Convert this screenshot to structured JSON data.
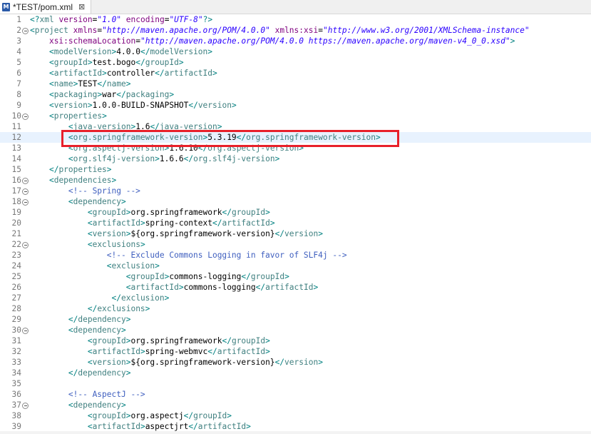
{
  "tab": {
    "title": "*TEST/pom.xml",
    "icon_letter": "M",
    "close_glyph": "⊠"
  },
  "colors": {
    "tag": "#3f7f7f",
    "attribute": "#7f007f",
    "attribute_value": "#2a00ff",
    "comment": "#3f5fbf",
    "highlight_box": "#e8202a"
  },
  "current_line": 12,
  "highlighted_line": 12,
  "lines": [
    {
      "n": "1",
      "fold": false,
      "indent": 0,
      "tokens": [
        [
          "p",
          "<?"
        ],
        [
          "t",
          "xml"
        ],
        [
          "x",
          " "
        ],
        [
          "a",
          "version"
        ],
        [
          "x",
          "="
        ],
        [
          "v",
          "\"1.0\""
        ],
        [
          "x",
          " "
        ],
        [
          "a",
          "encoding"
        ],
        [
          "x",
          "="
        ],
        [
          "v",
          "\"UTF-8\""
        ],
        [
          "p",
          "?>"
        ]
      ]
    },
    {
      "n": "2",
      "fold": true,
      "indent": 0,
      "tokens": [
        [
          "p",
          "<"
        ],
        [
          "t",
          "project"
        ],
        [
          "x",
          " "
        ],
        [
          "a",
          "xmlns"
        ],
        [
          "x",
          "="
        ],
        [
          "v",
          "\"http://maven.apache.org/POM/4.0.0\""
        ],
        [
          "x",
          " "
        ],
        [
          "a",
          "xmlns:xsi"
        ],
        [
          "x",
          "="
        ],
        [
          "v",
          "\"http://www.w3.org/2001/XMLSchema-instance\""
        ]
      ]
    },
    {
      "n": "3",
      "fold": false,
      "indent": 4,
      "tokens": [
        [
          "a",
          "xsi:schemaLocation"
        ],
        [
          "x",
          "="
        ],
        [
          "v",
          "\"http://maven.apache.org/POM/4.0.0 https://maven.apache.org/maven-v4_0_0.xsd\""
        ],
        [
          "p",
          ">"
        ]
      ]
    },
    {
      "n": "4",
      "fold": false,
      "indent": 4,
      "tokens": [
        [
          "p",
          "<"
        ],
        [
          "t",
          "modelVersion"
        ],
        [
          "p",
          ">"
        ],
        [
          "x",
          "4.0.0"
        ],
        [
          "p",
          "</"
        ],
        [
          "t",
          "modelVersion"
        ],
        [
          "p",
          ">"
        ]
      ]
    },
    {
      "n": "5",
      "fold": false,
      "indent": 4,
      "tokens": [
        [
          "p",
          "<"
        ],
        [
          "t",
          "groupId"
        ],
        [
          "p",
          ">"
        ],
        [
          "x",
          "test.bogo"
        ],
        [
          "p",
          "</"
        ],
        [
          "t",
          "groupId"
        ],
        [
          "p",
          ">"
        ]
      ]
    },
    {
      "n": "6",
      "fold": false,
      "indent": 4,
      "tokens": [
        [
          "p",
          "<"
        ],
        [
          "t",
          "artifactId"
        ],
        [
          "p",
          ">"
        ],
        [
          "x",
          "controller"
        ],
        [
          "p",
          "</"
        ],
        [
          "t",
          "artifactId"
        ],
        [
          "p",
          ">"
        ]
      ]
    },
    {
      "n": "7",
      "fold": false,
      "indent": 4,
      "tokens": [
        [
          "p",
          "<"
        ],
        [
          "t",
          "name"
        ],
        [
          "p",
          ">"
        ],
        [
          "x",
          "TEST"
        ],
        [
          "p",
          "</"
        ],
        [
          "t",
          "name"
        ],
        [
          "p",
          ">"
        ]
      ]
    },
    {
      "n": "8",
      "fold": false,
      "indent": 4,
      "tokens": [
        [
          "p",
          "<"
        ],
        [
          "t",
          "packaging"
        ],
        [
          "p",
          ">"
        ],
        [
          "x",
          "war"
        ],
        [
          "p",
          "</"
        ],
        [
          "t",
          "packaging"
        ],
        [
          "p",
          ">"
        ]
      ]
    },
    {
      "n": "9",
      "fold": false,
      "indent": 4,
      "tokens": [
        [
          "p",
          "<"
        ],
        [
          "t",
          "version"
        ],
        [
          "p",
          ">"
        ],
        [
          "x",
          "1.0.0-BUILD-SNAPSHOT"
        ],
        [
          "p",
          "</"
        ],
        [
          "t",
          "version"
        ],
        [
          "p",
          ">"
        ]
      ]
    },
    {
      "n": "10",
      "fold": true,
      "indent": 4,
      "tokens": [
        [
          "p",
          "<"
        ],
        [
          "t",
          "properties"
        ],
        [
          "p",
          ">"
        ]
      ]
    },
    {
      "n": "11",
      "fold": false,
      "indent": 8,
      "tokens": [
        [
          "p",
          "<"
        ],
        [
          "t",
          "java-version"
        ],
        [
          "p",
          ">"
        ],
        [
          "x",
          "1.6"
        ],
        [
          "p",
          "</"
        ],
        [
          "t",
          "java-version"
        ],
        [
          "p",
          ">"
        ]
      ]
    },
    {
      "n": "12",
      "fold": false,
      "indent": 8,
      "tokens": [
        [
          "p",
          "<"
        ],
        [
          "t",
          "org.springframework-version"
        ],
        [
          "p",
          ">"
        ],
        [
          "x",
          "5.3.19"
        ],
        [
          "p",
          "</"
        ],
        [
          "t",
          "org.springframework-version"
        ],
        [
          "p",
          ">"
        ]
      ]
    },
    {
      "n": "13",
      "fold": false,
      "indent": 8,
      "tokens": [
        [
          "p",
          "<"
        ],
        [
          "t",
          "org.aspectj-version"
        ],
        [
          "p",
          ">"
        ],
        [
          "x",
          "1.6.10"
        ],
        [
          "p",
          "</"
        ],
        [
          "t",
          "org.aspectj-version"
        ],
        [
          "p",
          ">"
        ]
      ]
    },
    {
      "n": "14",
      "fold": false,
      "indent": 8,
      "tokens": [
        [
          "p",
          "<"
        ],
        [
          "t",
          "org.slf4j-version"
        ],
        [
          "p",
          ">"
        ],
        [
          "x",
          "1.6.6"
        ],
        [
          "p",
          "</"
        ],
        [
          "t",
          "org.slf4j-version"
        ],
        [
          "p",
          ">"
        ]
      ]
    },
    {
      "n": "15",
      "fold": false,
      "indent": 4,
      "tokens": [
        [
          "p",
          "</"
        ],
        [
          "t",
          "properties"
        ],
        [
          "p",
          ">"
        ]
      ]
    },
    {
      "n": "16",
      "fold": true,
      "indent": 4,
      "tokens": [
        [
          "p",
          "<"
        ],
        [
          "t",
          "dependencies"
        ],
        [
          "p",
          ">"
        ]
      ]
    },
    {
      "n": "17",
      "fold": true,
      "indent": 8,
      "tokens": [
        [
          "c",
          "<!-- Spring -->"
        ]
      ]
    },
    {
      "n": "18",
      "fold": true,
      "indent": 8,
      "tokens": [
        [
          "p",
          "<"
        ],
        [
          "t",
          "dependency"
        ],
        [
          "p",
          ">"
        ]
      ]
    },
    {
      "n": "19",
      "fold": false,
      "indent": 12,
      "tokens": [
        [
          "p",
          "<"
        ],
        [
          "t",
          "groupId"
        ],
        [
          "p",
          ">"
        ],
        [
          "x",
          "org.springframework"
        ],
        [
          "p",
          "</"
        ],
        [
          "t",
          "groupId"
        ],
        [
          "p",
          ">"
        ]
      ]
    },
    {
      "n": "20",
      "fold": false,
      "indent": 12,
      "tokens": [
        [
          "p",
          "<"
        ],
        [
          "t",
          "artifactId"
        ],
        [
          "p",
          ">"
        ],
        [
          "x",
          "spring-context"
        ],
        [
          "p",
          "</"
        ],
        [
          "t",
          "artifactId"
        ],
        [
          "p",
          ">"
        ]
      ]
    },
    {
      "n": "21",
      "fold": false,
      "indent": 12,
      "tokens": [
        [
          "p",
          "<"
        ],
        [
          "t",
          "version"
        ],
        [
          "p",
          ">"
        ],
        [
          "x",
          "${org.springframework-version}"
        ],
        [
          "p",
          "</"
        ],
        [
          "t",
          "version"
        ],
        [
          "p",
          ">"
        ]
      ]
    },
    {
      "n": "22",
      "fold": true,
      "indent": 12,
      "tokens": [
        [
          "p",
          "<"
        ],
        [
          "t",
          "exclusions"
        ],
        [
          "p",
          ">"
        ]
      ]
    },
    {
      "n": "23",
      "fold": false,
      "indent": 16,
      "tokens": [
        [
          "c",
          "<!-- Exclude Commons Logging in favor of SLF4j -->"
        ]
      ]
    },
    {
      "n": "24",
      "fold": false,
      "indent": 16,
      "tokens": [
        [
          "p",
          "<"
        ],
        [
          "t",
          "exclusion"
        ],
        [
          "p",
          ">"
        ]
      ]
    },
    {
      "n": "25",
      "fold": false,
      "indent": 20,
      "tokens": [
        [
          "p",
          "<"
        ],
        [
          "t",
          "groupId"
        ],
        [
          "p",
          ">"
        ],
        [
          "x",
          "commons-logging"
        ],
        [
          "p",
          "</"
        ],
        [
          "t",
          "groupId"
        ],
        [
          "p",
          ">"
        ]
      ]
    },
    {
      "n": "26",
      "fold": false,
      "indent": 20,
      "tokens": [
        [
          "p",
          "<"
        ],
        [
          "t",
          "artifactId"
        ],
        [
          "p",
          ">"
        ],
        [
          "x",
          "commons-logging"
        ],
        [
          "p",
          "</"
        ],
        [
          "t",
          "artifactId"
        ],
        [
          "p",
          ">"
        ]
      ]
    },
    {
      "n": "27",
      "fold": false,
      "indent": 17,
      "tokens": [
        [
          "p",
          "</"
        ],
        [
          "t",
          "exclusion"
        ],
        [
          "p",
          ">"
        ]
      ]
    },
    {
      "n": "28",
      "fold": false,
      "indent": 12,
      "tokens": [
        [
          "p",
          "</"
        ],
        [
          "t",
          "exclusions"
        ],
        [
          "p",
          ">"
        ]
      ]
    },
    {
      "n": "29",
      "fold": false,
      "indent": 8,
      "tokens": [
        [
          "p",
          "</"
        ],
        [
          "t",
          "dependency"
        ],
        [
          "p",
          ">"
        ]
      ]
    },
    {
      "n": "30",
      "fold": true,
      "indent": 8,
      "tokens": [
        [
          "p",
          "<"
        ],
        [
          "t",
          "dependency"
        ],
        [
          "p",
          ">"
        ]
      ]
    },
    {
      "n": "31",
      "fold": false,
      "indent": 12,
      "tokens": [
        [
          "p",
          "<"
        ],
        [
          "t",
          "groupId"
        ],
        [
          "p",
          ">"
        ],
        [
          "x",
          "org.springframework"
        ],
        [
          "p",
          "</"
        ],
        [
          "t",
          "groupId"
        ],
        [
          "p",
          ">"
        ]
      ]
    },
    {
      "n": "32",
      "fold": false,
      "indent": 12,
      "tokens": [
        [
          "p",
          "<"
        ],
        [
          "t",
          "artifactId"
        ],
        [
          "p",
          ">"
        ],
        [
          "x",
          "spring-webmvc"
        ],
        [
          "p",
          "</"
        ],
        [
          "t",
          "artifactId"
        ],
        [
          "p",
          ">"
        ]
      ]
    },
    {
      "n": "33",
      "fold": false,
      "indent": 12,
      "tokens": [
        [
          "p",
          "<"
        ],
        [
          "t",
          "version"
        ],
        [
          "p",
          ">"
        ],
        [
          "x",
          "${org.springframework-version}"
        ],
        [
          "p",
          "</"
        ],
        [
          "t",
          "version"
        ],
        [
          "p",
          ">"
        ]
      ]
    },
    {
      "n": "34",
      "fold": false,
      "indent": 8,
      "tokens": [
        [
          "p",
          "</"
        ],
        [
          "t",
          "dependency"
        ],
        [
          "p",
          ">"
        ]
      ]
    },
    {
      "n": "35",
      "fold": false,
      "indent": 0,
      "tokens": []
    },
    {
      "n": "36",
      "fold": false,
      "indent": 8,
      "tokens": [
        [
          "c",
          "<!-- AspectJ -->"
        ]
      ]
    },
    {
      "n": "37",
      "fold": true,
      "indent": 8,
      "tokens": [
        [
          "p",
          "<"
        ],
        [
          "t",
          "dependency"
        ],
        [
          "p",
          ">"
        ]
      ]
    },
    {
      "n": "38",
      "fold": false,
      "indent": 12,
      "tokens": [
        [
          "p",
          "<"
        ],
        [
          "t",
          "groupId"
        ],
        [
          "p",
          ">"
        ],
        [
          "x",
          "org.aspectj"
        ],
        [
          "p",
          "</"
        ],
        [
          "t",
          "groupId"
        ],
        [
          "p",
          ">"
        ]
      ]
    },
    {
      "n": "39",
      "fold": false,
      "indent": 12,
      "tokens": [
        [
          "p",
          "<"
        ],
        [
          "t",
          "artifactId"
        ],
        [
          "p",
          ">"
        ],
        [
          "x",
          "aspectjrt"
        ],
        [
          "p",
          "</"
        ],
        [
          "t",
          "artifactId"
        ],
        [
          "p",
          ">"
        ]
      ]
    }
  ]
}
